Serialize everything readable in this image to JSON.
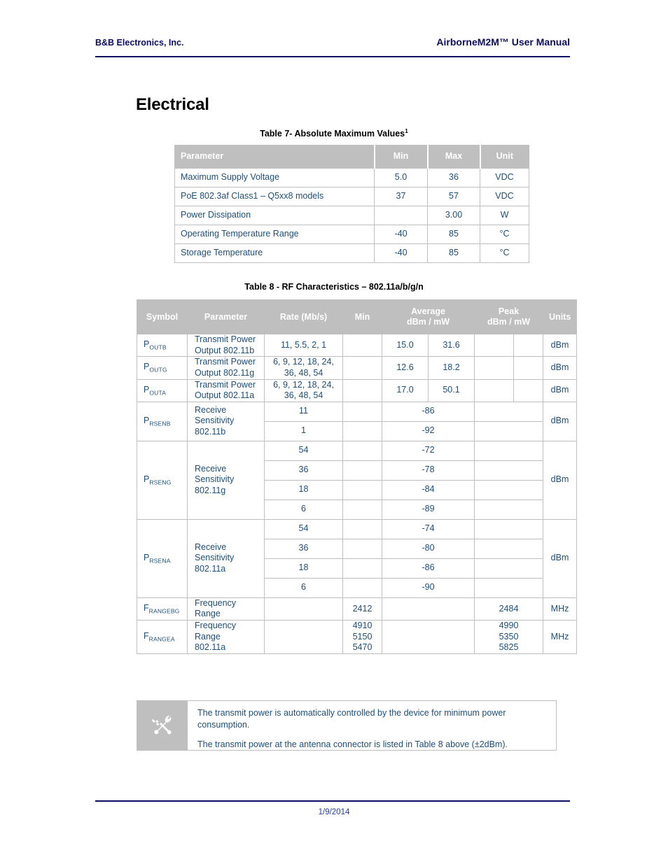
{
  "header": {
    "left": "B&B Electronics, Inc.",
    "right": "AirborneM2M™ User Manual"
  },
  "section": {
    "title": "Electrical"
  },
  "table7": {
    "caption": "Table 7- Absolute Maximum Values",
    "caption_superscript": "1",
    "columns": [
      "Parameter",
      "Min",
      "Max",
      "Unit"
    ],
    "rows": [
      {
        "parameter": "Maximum Supply Voltage",
        "min": "5.0",
        "max": "36",
        "unit": "VDC"
      },
      {
        "parameter": "PoE 802.3af Class1 – Q5xx8 models",
        "min": "37",
        "max": "57",
        "unit": "VDC"
      },
      {
        "parameter": "Power Dissipation",
        "min": "",
        "max": "3.00",
        "unit": "W"
      },
      {
        "parameter": "Operating Temperature Range",
        "min": "-40",
        "max": "85",
        "unit": "°C"
      },
      {
        "parameter": "Storage Temperature",
        "min": "-40",
        "max": "85",
        "unit": "°C"
      }
    ]
  },
  "table8": {
    "caption": "Table 8 - RF Characteristics – 802.11a/b/g/n",
    "columns": {
      "symbol": "Symbol",
      "parameter": "Parameter",
      "rate": "Rate (Mb/s)",
      "min": "Min",
      "average_line1": "Average",
      "average_line2": "dBm / mW",
      "peak_line1": "Peak",
      "peak_line2": "dBm / mW",
      "units": "Units"
    },
    "groups": [
      {
        "symbol_base": "P",
        "symbol_sub": "OUTB",
        "parameter": "Transmit Power\nOutput 802.11b",
        "units": "dBm",
        "rows": [
          {
            "rate": "11, 5.5, 2, 1",
            "min": "",
            "avg_dbm": "15.0",
            "avg_mw": "31.6",
            "peak_dbm": "",
            "peak_mw": ""
          }
        ]
      },
      {
        "symbol_base": "P",
        "symbol_sub": "OUTG",
        "parameter": "Transmit Power\nOutput 802.11g",
        "units": "dBm",
        "rows": [
          {
            "rate": "6, 9, 12, 18, 24,\n36, 48, 54",
            "min": "",
            "avg_dbm": "12.6",
            "avg_mw": "18.2",
            "peak_dbm": "",
            "peak_mw": ""
          }
        ]
      },
      {
        "symbol_base": "P",
        "symbol_sub": "OUTA",
        "parameter": "Transmit Power\nOutput 802.11a",
        "units": "dBm",
        "rows": [
          {
            "rate": "6, 9, 12, 18, 24,\n36, 48, 54",
            "min": "",
            "avg_dbm": "17.0",
            "avg_mw": "50.1",
            "peak_dbm": "",
            "peak_mw": ""
          }
        ]
      },
      {
        "symbol_base": "P",
        "symbol_sub": "RSENB",
        "parameter": "Receive\nSensitivity\n802.11b",
        "units": "dBm",
        "rows": [
          {
            "rate": "11",
            "min": "",
            "average": "-86",
            "peak": ""
          },
          {
            "rate": "1",
            "min": "",
            "average": "-92",
            "peak": ""
          }
        ]
      },
      {
        "symbol_base": "P",
        "symbol_sub": "RSENG",
        "parameter": "Receive\nSensitivity\n802.11g",
        "units": "dBm",
        "rows": [
          {
            "rate": "54",
            "min": "",
            "average": "-72",
            "peak": ""
          },
          {
            "rate": "36",
            "min": "",
            "average": "-78",
            "peak": ""
          },
          {
            "rate": "18",
            "min": "",
            "average": "-84",
            "peak": ""
          },
          {
            "rate": "6",
            "min": "",
            "average": "-89",
            "peak": ""
          }
        ]
      },
      {
        "symbol_base": "P",
        "symbol_sub": "RSENA",
        "parameter": "Receive\nSensitivity\n802.11a",
        "units": "dBm",
        "rows": [
          {
            "rate": "54",
            "min": "",
            "average": "-74",
            "peak": ""
          },
          {
            "rate": "36",
            "min": "",
            "average": "-80",
            "peak": ""
          },
          {
            "rate": "18",
            "min": "",
            "average": "-86",
            "peak": ""
          },
          {
            "rate": "6",
            "min": "",
            "average": "-90",
            "peak": ""
          }
        ]
      },
      {
        "symbol_base": "F",
        "symbol_sub": "RANGEBG",
        "parameter": "Frequency\nRange",
        "units": "MHz",
        "rows": [
          {
            "rate": "",
            "min": "2412",
            "average": "",
            "peak": "2484"
          }
        ]
      },
      {
        "symbol_base": "F",
        "symbol_sub": "RANGEA",
        "parameter": "Frequency\nRange\n802.11a",
        "units": "MHz",
        "rows": [
          {
            "rate": "",
            "min": "4910\n5150\n5470",
            "average": "",
            "peak": "4990\n5350\n5825"
          }
        ]
      }
    ]
  },
  "note": {
    "icon": "tools-icon",
    "paragraphs": [
      "The transmit power is automatically controlled by the device for minimum power consumption.",
      "The transmit power at the antenna connector is listed in Table 8 above (±2dBm)."
    ]
  },
  "footer": {
    "date": "1/9/2014"
  },
  "colors": {
    "header_navy": "#0d0d63",
    "table_header_gray": "#bfbfbf",
    "body_blue": "#1f4e79",
    "footer_blue": "#1f3fa8"
  }
}
